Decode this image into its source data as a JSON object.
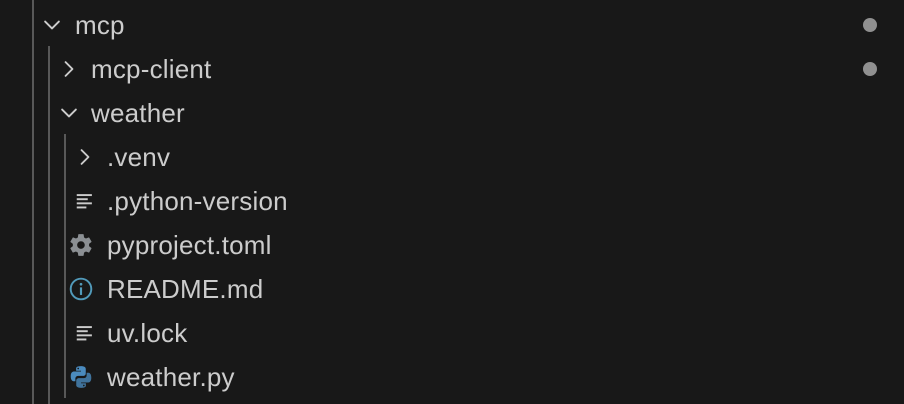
{
  "explorer": {
    "root": {
      "label": "mcp",
      "expanded": true,
      "icon": "chevron-down-icon",
      "has_change_dot": true
    },
    "mcp_client": {
      "label": "mcp-client",
      "expanded": false,
      "icon": "chevron-right-icon",
      "has_change_dot": true
    },
    "weather": {
      "label": "weather",
      "expanded": true,
      "icon": "chevron-down-icon",
      "children": [
        {
          "label": ".venv",
          "icon": "chevron-right-icon",
          "kind": "folder"
        },
        {
          "label": ".python-version",
          "icon": "lines-file-icon",
          "kind": "file"
        },
        {
          "label": "pyproject.toml",
          "icon": "gear-icon",
          "kind": "file"
        },
        {
          "label": "README.md",
          "icon": "info-icon",
          "kind": "file"
        },
        {
          "label": "uv.lock",
          "icon": "lines-file-icon",
          "kind": "file"
        },
        {
          "label": "weather.py",
          "icon": "python-icon",
          "kind": "file"
        }
      ]
    },
    "colors": {
      "background": "#181818",
      "text": "#cccccc",
      "guide": "#585858",
      "dot": "#a6a6a6",
      "info_icon": "#519aba",
      "python_icon": "#4b8bbe"
    }
  }
}
